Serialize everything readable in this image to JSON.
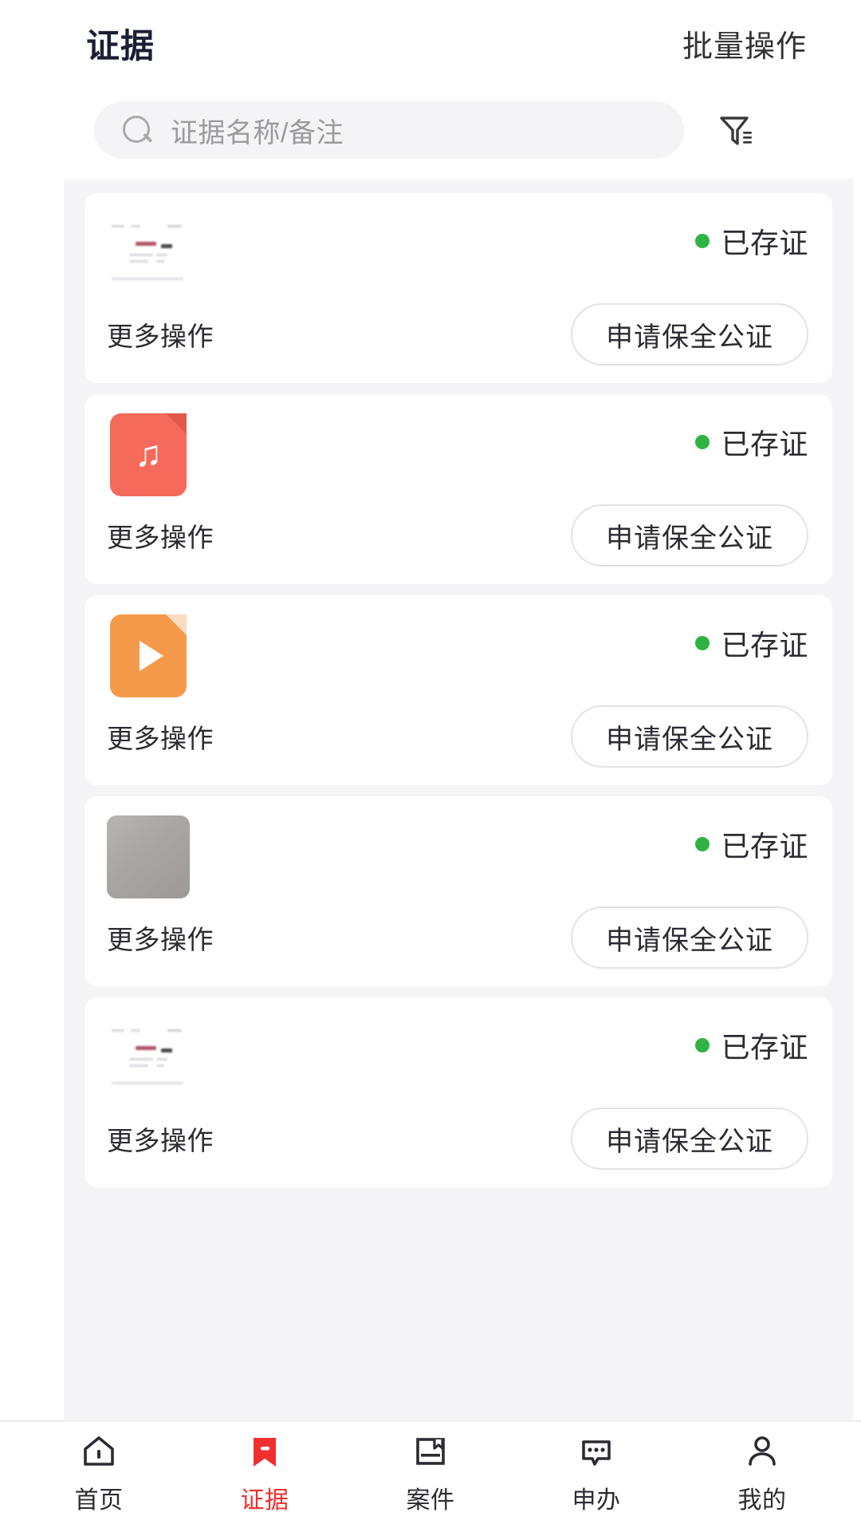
{
  "header": {
    "title": "证据",
    "action_label": "批量操作"
  },
  "search": {
    "placeholder": "证据名称/备注",
    "value": "",
    "icon": "search-icon",
    "filter_icon": "filter-funnel-icon"
  },
  "colors": {
    "accent": "#f03030",
    "status_green": "#2fb344",
    "page_bg": "#f5f5f7",
    "card_bg": "#ffffff",
    "title_color": "#1b1f33",
    "audio_icon": "#f56a5a",
    "video_icon": "#f59a4b"
  },
  "list": {
    "cards": [
      {
        "thumb_type": "document-thumbnail",
        "name": "",
        "sub": "",
        "status_label": "已存证",
        "more_label": "更多操作",
        "action_label": "申请保全公证"
      },
      {
        "thumb_type": "audio-file-icon",
        "name": "",
        "sub": "",
        "status_label": "已存证",
        "more_label": "更多操作",
        "action_label": "申请保全公证"
      },
      {
        "thumb_type": "video-file-icon",
        "name": "",
        "sub": "",
        "status_label": "已存证",
        "more_label": "更多操作",
        "action_label": "申请保全公证"
      },
      {
        "thumb_type": "photo-thumbnail",
        "name": "",
        "sub": "",
        "status_label": "已存证",
        "more_label": "更多操作",
        "action_label": "申请保全公证"
      },
      {
        "thumb_type": "document-thumbnail",
        "name": "",
        "sub": "",
        "status_label": "已存证",
        "more_label": "更多操作",
        "action_label": "申请保全公证"
      }
    ]
  },
  "tabbar": {
    "items": [
      {
        "label": "首页",
        "icon": "home-icon",
        "active": false
      },
      {
        "label": "证据",
        "icon": "bookmark-icon",
        "active": true
      },
      {
        "label": "案件",
        "icon": "case-folder-icon",
        "active": false
      },
      {
        "label": "申办",
        "icon": "chat-bubble-icon",
        "active": false
      },
      {
        "label": "我的",
        "icon": "person-icon",
        "active": false
      }
    ]
  }
}
